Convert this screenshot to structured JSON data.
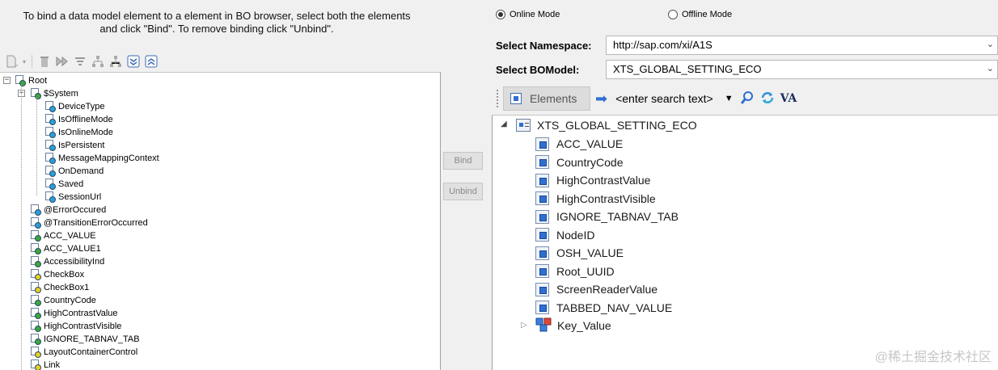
{
  "instructions": {
    "line1": "To bind a data model element to a element in BO browser, select both the elements",
    "line2": "and click \"Bind\". To remove binding click \"Unbind\"."
  },
  "left_tree": {
    "root": "Root",
    "system": "$System",
    "system_children": [
      "DeviceType",
      "IsOfflineMode",
      "IsOnlineMode",
      "IsPersistent",
      "MessageMappingContext",
      "OnDemand",
      "Saved",
      "SessionUrl"
    ],
    "items": [
      {
        "label": "@ErrorOccured",
        "dot": "#2a9fd8"
      },
      {
        "label": "@TransitionErrorOccurred",
        "dot": "#2a9fd8"
      },
      {
        "label": "ACC_VALUE",
        "dot": "#3aa83a"
      },
      {
        "label": "ACC_VALUE1",
        "dot": "#3aa83a"
      },
      {
        "label": "AccessibilityInd",
        "dot": "#3aa83a"
      },
      {
        "label": "CheckBox",
        "dot": "#e8d020"
      },
      {
        "label": "CheckBox1",
        "dot": "#e8d020"
      },
      {
        "label": "CountryCode",
        "dot": "#3aa83a"
      },
      {
        "label": "HighContrastValue",
        "dot": "#3aa83a"
      },
      {
        "label": "HighContrastVisible",
        "dot": "#3aa83a"
      },
      {
        "label": "IGNORE_TABNAV_TAB",
        "dot": "#3aa83a"
      },
      {
        "label": "LayoutContainerControl",
        "dot": "#e8d020"
      },
      {
        "label": "Link",
        "dot": "#e8d020"
      }
    ]
  },
  "buttons": {
    "bind": "Bind",
    "unbind": "Unbind"
  },
  "mode": {
    "online": "Online Mode",
    "offline": "Offline Mode",
    "selected": "online"
  },
  "namespace": {
    "label": "Select Namespace:",
    "value": "http://sap.com/xi/A1S"
  },
  "bomodel": {
    "label": "Select BOModel:",
    "value": "XTS_GLOBAL_SETTING_ECO"
  },
  "elements_toolbar": {
    "label": "Elements",
    "search_placeholder": "<enter search text>"
  },
  "bo_tree": {
    "root": "XTS_GLOBAL_SETTING_ECO",
    "items": [
      "ACC_VALUE",
      "CountryCode",
      "HighContrastValue",
      "HighContrastVisible",
      "IGNORE_TABNAV_TAB",
      "NodeID",
      "OSH_VALUE",
      "Root_UUID",
      "ScreenReaderValue",
      "TABBED_NAV_VALUE"
    ],
    "association": "Key_Value"
  },
  "watermark": "@稀土掘金技术社区",
  "colors": {
    "system_dot": "#2a9fd8",
    "green_dot": "#3aa83a",
    "yellow_dot": "#e8d020",
    "accent_blue": "#2f6fd0"
  }
}
